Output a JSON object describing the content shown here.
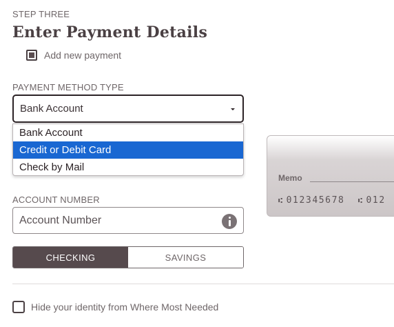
{
  "step": {
    "label": "STEP THREE"
  },
  "title": "Enter Payment Details",
  "add_payment": {
    "label": "Add new payment",
    "checked": true
  },
  "payment_method": {
    "label": "PAYMENT METHOD TYPE",
    "selected": "Bank Account",
    "options": [
      "Bank Account",
      "Credit or Debit Card",
      "Check by Mail"
    ],
    "highlighted": "Credit or Debit Card"
  },
  "check_image": {
    "memo_label": "Memo",
    "routing_text": "012345678",
    "routing_text_2": "012"
  },
  "account_number": {
    "label": "ACCOUNT NUMBER",
    "placeholder": "Account Number"
  },
  "account_type": {
    "options": [
      "CHECKING",
      "SAVINGS"
    ],
    "selected": "CHECKING"
  },
  "hide_identity": {
    "label": "Hide your identity from Where Most Needed",
    "checked": false
  },
  "colors": {
    "highlight": "#1967d2",
    "toggle_active": "#564a4d",
    "text": "#4a4043"
  }
}
